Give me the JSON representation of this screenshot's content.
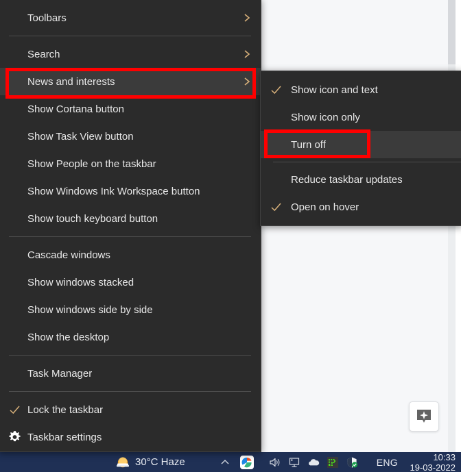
{
  "window": {
    "app_background_color": "#f6f7f9",
    "scrollbar_present": true
  },
  "float_button": {
    "icon": "sparkle-badge-icon",
    "label": ""
  },
  "context_menu": {
    "name": "taskbar-context-menu",
    "background_color": "#2b2b2b",
    "text_color": "#e8e8e8",
    "groups": [
      {
        "items": [
          {
            "label": "Toolbars",
            "submenu": true,
            "checked": false,
            "icon": ""
          }
        ]
      },
      {
        "items": [
          {
            "label": "Search",
            "submenu": true,
            "checked": false,
            "icon": ""
          },
          {
            "label": "News and interests",
            "submenu": true,
            "checked": false,
            "icon": "",
            "selected": true
          },
          {
            "label": "Show Cortana button",
            "submenu": false,
            "checked": false,
            "icon": ""
          },
          {
            "label": "Show Task View button",
            "submenu": false,
            "checked": false,
            "icon": ""
          },
          {
            "label": "Show People on the taskbar",
            "submenu": false,
            "checked": false,
            "icon": ""
          },
          {
            "label": "Show Windows Ink Workspace button",
            "submenu": false,
            "checked": false,
            "icon": ""
          },
          {
            "label": "Show touch keyboard button",
            "submenu": false,
            "checked": false,
            "icon": ""
          }
        ]
      },
      {
        "items": [
          {
            "label": "Cascade windows",
            "submenu": false,
            "checked": false,
            "icon": ""
          },
          {
            "label": "Show windows stacked",
            "submenu": false,
            "checked": false,
            "icon": ""
          },
          {
            "label": "Show windows side by side",
            "submenu": false,
            "checked": false,
            "icon": ""
          },
          {
            "label": "Show the desktop",
            "submenu": false,
            "checked": false,
            "icon": ""
          }
        ]
      },
      {
        "items": [
          {
            "label": "Task Manager",
            "submenu": false,
            "checked": false,
            "icon": ""
          }
        ]
      },
      {
        "items": [
          {
            "label": "Lock the taskbar",
            "submenu": false,
            "checked": true,
            "icon": "check-icon"
          },
          {
            "label": "Taskbar settings",
            "submenu": false,
            "checked": false,
            "icon": "gear-icon"
          }
        ]
      }
    ]
  },
  "submenu": {
    "name": "news-and-interests-submenu",
    "groups": [
      {
        "items": [
          {
            "label": "Show icon and text",
            "checked": true
          },
          {
            "label": "Show icon only",
            "checked": false
          },
          {
            "label": "Turn off",
            "checked": false,
            "selected": true
          }
        ]
      },
      {
        "items": [
          {
            "label": "Reduce taskbar updates",
            "checked": false
          },
          {
            "label": "Open on hover",
            "checked": true
          }
        ]
      }
    ]
  },
  "annotations": {
    "color": "#ff0000",
    "boxes": [
      {
        "target": "News and interests"
      },
      {
        "target": "Turn off"
      }
    ]
  },
  "taskbar": {
    "background_color": "#1f3055",
    "weather": {
      "text": "30°C  Haze",
      "icon": "sun-cloud-icon"
    },
    "tray_icons": [
      "volume-icon",
      "network-display-icon",
      "onedrive-cloud-icon",
      "green-app-icon",
      "windows-defender-shield-icon"
    ],
    "language": "ENG",
    "clock": {
      "time": "10:33",
      "date": "19-03-2022"
    },
    "overflow_chevron": "chevron-up-icon",
    "edge_icon": "edge-browser-icon"
  }
}
